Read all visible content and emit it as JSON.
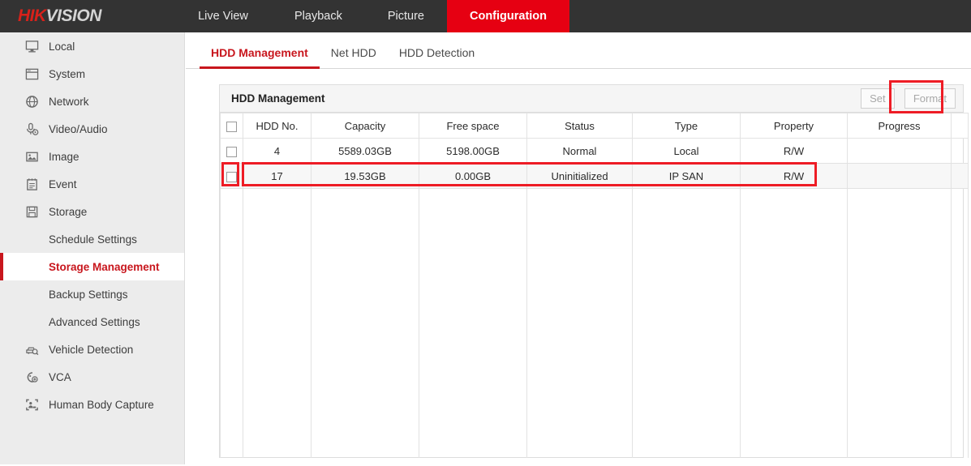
{
  "brand": {
    "logo_prefix": "HIK",
    "logo_suffix": "VISION",
    "accent_red": "#e60012",
    "dark_header": "#333333",
    "link_red": "#c8161d",
    "annotation_red": "#ee1c25"
  },
  "topnav": {
    "items": [
      {
        "label": "Live View",
        "active": false
      },
      {
        "label": "Playback",
        "active": false
      },
      {
        "label": "Picture",
        "active": false
      },
      {
        "label": "Configuration",
        "active": true
      }
    ]
  },
  "sidebar": {
    "items": [
      {
        "label": "Local",
        "icon": "monitor-icon",
        "sub": false,
        "active": false
      },
      {
        "label": "System",
        "icon": "window-icon",
        "sub": false,
        "active": false
      },
      {
        "label": "Network",
        "icon": "globe-icon",
        "sub": false,
        "active": false
      },
      {
        "label": "Video/Audio",
        "icon": "microphone-icon",
        "sub": false,
        "active": false
      },
      {
        "label": "Image",
        "icon": "picture-icon",
        "sub": false,
        "active": false
      },
      {
        "label": "Event",
        "icon": "calendar-icon",
        "sub": false,
        "active": false
      },
      {
        "label": "Storage",
        "icon": "floppy-disk-icon",
        "sub": false,
        "active": false
      },
      {
        "label": "Schedule Settings",
        "icon": "",
        "sub": true,
        "active": false
      },
      {
        "label": "Storage Management",
        "icon": "",
        "sub": true,
        "active": true
      },
      {
        "label": "Backup Settings",
        "icon": "",
        "sub": true,
        "active": false
      },
      {
        "label": "Advanced Settings",
        "icon": "",
        "sub": true,
        "active": false
      },
      {
        "label": "Vehicle Detection",
        "icon": "vehicle-search-icon",
        "sub": false,
        "active": false
      },
      {
        "label": "VCA",
        "icon": "vca-icon",
        "sub": false,
        "active": false
      },
      {
        "label": "Human Body Capture",
        "icon": "human-capture-icon",
        "sub": false,
        "active": false
      }
    ]
  },
  "subtabs": {
    "items": [
      {
        "label": "HDD Management",
        "active": true
      },
      {
        "label": "Net HDD",
        "active": false
      },
      {
        "label": "HDD Detection",
        "active": false
      }
    ]
  },
  "panel": {
    "title": "HDD Management",
    "buttons": {
      "set": "Set",
      "format": "Format"
    }
  },
  "table": {
    "headers": [
      "HDD No.",
      "Capacity",
      "Free space",
      "Status",
      "Type",
      "Property",
      "Progress"
    ],
    "rows": [
      {
        "checked": false,
        "hdd_no": "4",
        "capacity": "5589.03GB",
        "free_space": "5198.00GB",
        "status": "Normal",
        "type": "Local",
        "property": "R/W",
        "progress": ""
      },
      {
        "checked": false,
        "hdd_no": "17",
        "capacity": "19.53GB",
        "free_space": "0.00GB",
        "status": "Uninitialized",
        "type": "IP SAN",
        "property": "R/W",
        "progress": ""
      }
    ]
  }
}
